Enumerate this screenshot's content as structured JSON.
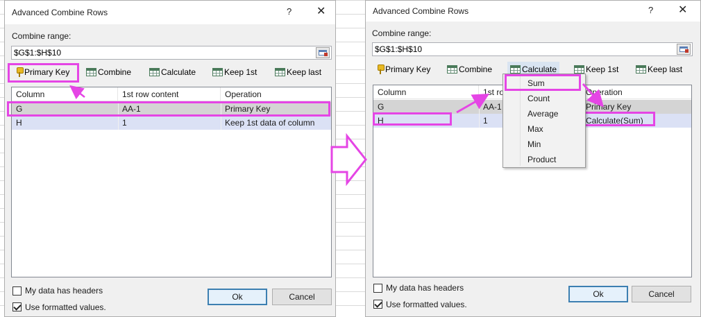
{
  "left_dialog": {
    "title": "Advanced Combine Rows",
    "help": "?",
    "close": "✕",
    "range_label": "Combine range:",
    "range_value": "$G$1:$H$10",
    "toolbar": [
      "Primary Key",
      "Combine",
      "Calculate",
      "Keep 1st",
      "Keep last"
    ],
    "columns": [
      "Column",
      "1st row content",
      "Operation"
    ],
    "rows": [
      [
        "G",
        "AA-1",
        "Primary Key"
      ],
      [
        "H",
        "1",
        "Keep 1st data of column"
      ]
    ],
    "checkbox_headers": "My data has headers",
    "checkbox_formatted": "Use formatted values.",
    "ok": "Ok",
    "cancel": "Cancel"
  },
  "right_dialog": {
    "title": "Advanced Combine Rows",
    "help": "?",
    "close": "✕",
    "range_label": "Combine range:",
    "range_value": "$G$1:$H$10",
    "toolbar": [
      "Primary Key",
      "Combine",
      "Calculate",
      "Keep 1st",
      "Keep last"
    ],
    "columns": [
      "Column",
      "1st ro",
      "Operation"
    ],
    "rows": [
      [
        "G",
        "AA-1",
        "Primary Key"
      ],
      [
        "H",
        "1",
        "Calculate(Sum)"
      ]
    ],
    "menu": [
      "Sum",
      "Count",
      "Average",
      "Max",
      "Min",
      "Product"
    ],
    "checkbox_headers": "My data has headers",
    "checkbox_formatted": "Use formatted values.",
    "ok": "Ok",
    "cancel": "Cancel"
  },
  "colors": {
    "highlight": "#e545e5",
    "row_selected": "#dbe1f5",
    "row_gray": "#d4d4d4",
    "default_button_border": "#3c7fb1"
  },
  "icons": {
    "primary_key": "key-icon",
    "grid_buttons": "table-grid-icon",
    "range_select": "range-select-icon",
    "arrow_between": "right-arrow-icon"
  }
}
